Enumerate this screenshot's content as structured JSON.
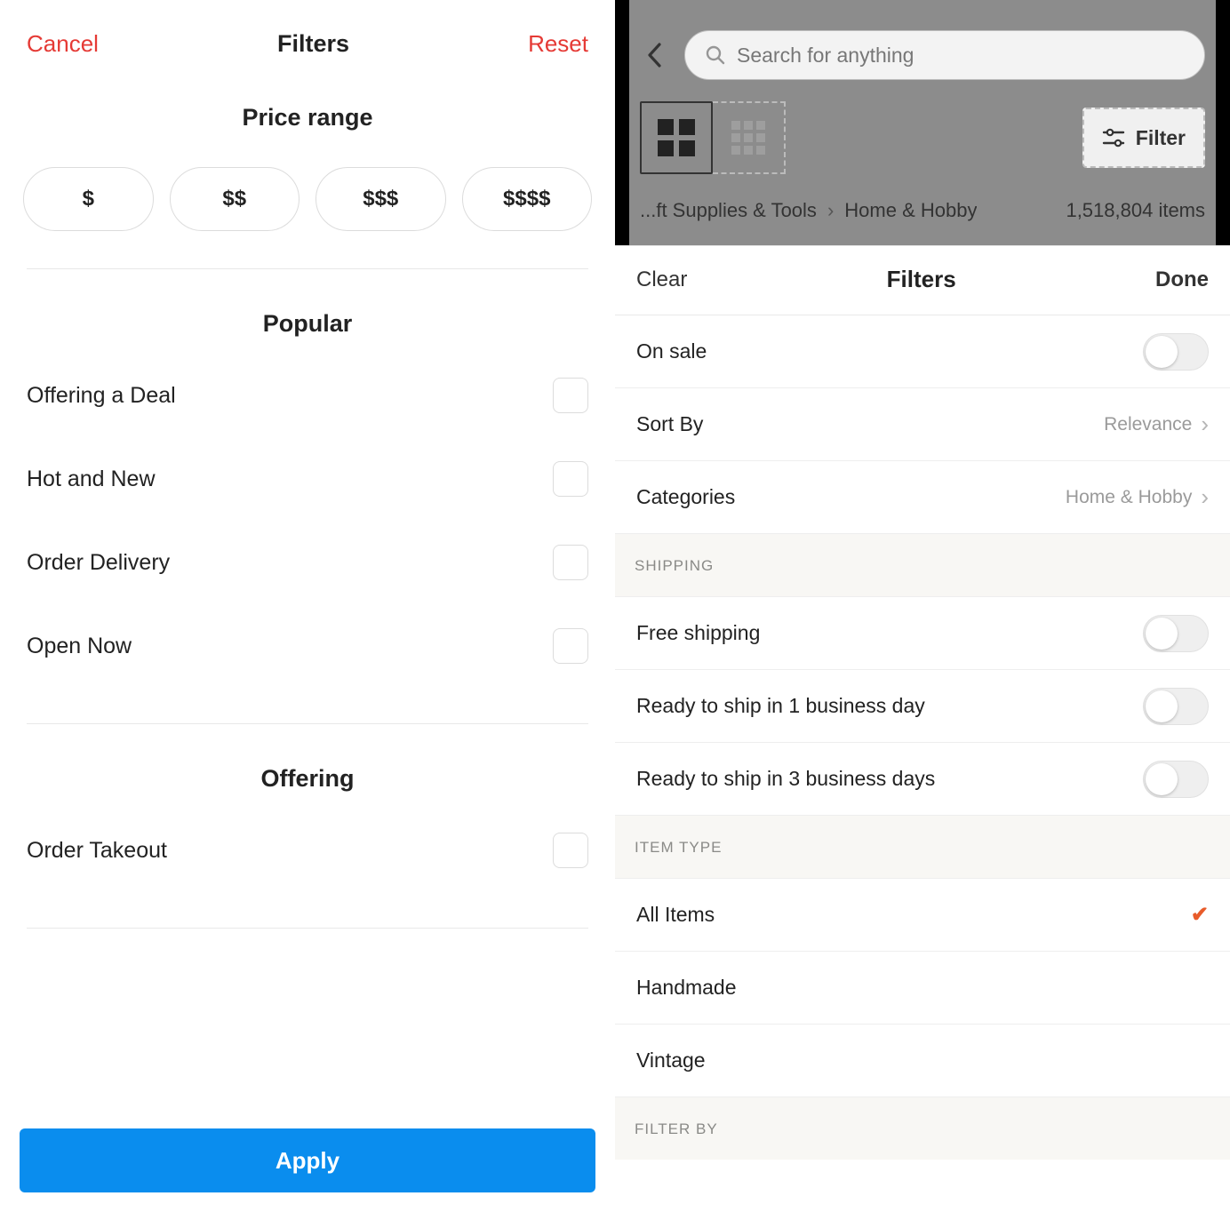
{
  "left": {
    "header": {
      "cancel": "Cancel",
      "title": "Filters",
      "reset": "Reset"
    },
    "price": {
      "title": "Price range",
      "options": [
        "$",
        "$$",
        "$$$",
        "$$$$"
      ]
    },
    "popular": {
      "title": "Popular",
      "items": [
        {
          "label": "Offering a Deal",
          "checked": false
        },
        {
          "label": "Hot and New",
          "checked": false
        },
        {
          "label": "Order Delivery",
          "checked": false
        },
        {
          "label": "Open Now",
          "checked": false
        }
      ]
    },
    "offering": {
      "title": "Offering",
      "items": [
        {
          "label": "Order Takeout",
          "checked": false
        }
      ]
    },
    "apply": "Apply"
  },
  "right": {
    "search": {
      "placeholder": "Search for anything"
    },
    "filter_button": "Filter",
    "breadcrumb": {
      "prefix": "...ft Supplies & Tools",
      "current": "Home & Hobby"
    },
    "count": "1,518,804 items",
    "sheet": {
      "clear": "Clear",
      "title": "Filters",
      "done": "Done",
      "top_rows": [
        {
          "type": "toggle",
          "label": "On sale",
          "on": false
        },
        {
          "type": "nav",
          "label": "Sort By",
          "value": "Relevance"
        },
        {
          "type": "nav",
          "label": "Categories",
          "value": "Home & Hobby"
        }
      ],
      "groups": [
        {
          "header": "SHIPPING",
          "rows": [
            {
              "type": "toggle",
              "label": "Free shipping",
              "on": false
            },
            {
              "type": "toggle",
              "label": "Ready to ship in 1 business day",
              "on": false
            },
            {
              "type": "toggle",
              "label": "Ready to ship in 3 business days",
              "on": false
            }
          ]
        },
        {
          "header": "ITEM TYPE",
          "rows": [
            {
              "type": "radio",
              "label": "All Items",
              "selected": true
            },
            {
              "type": "radio",
              "label": "Handmade",
              "selected": false
            },
            {
              "type": "radio",
              "label": "Vintage",
              "selected": false
            }
          ]
        },
        {
          "header": "FILTER BY",
          "rows": []
        }
      ]
    }
  }
}
